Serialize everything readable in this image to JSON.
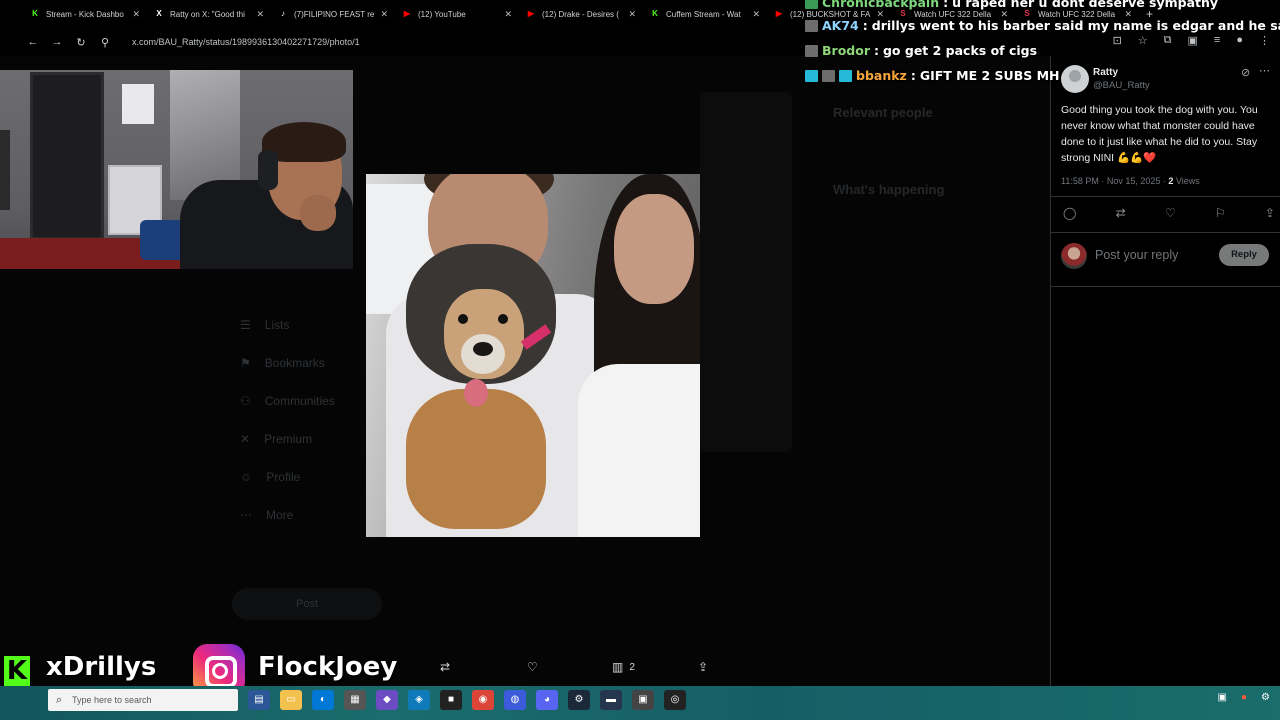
{
  "browser": {
    "tabs": [
      {
        "label": "Stream - Kick Dashbo",
        "icon": "kick-icon",
        "color": "#53fc18"
      },
      {
        "label": "Ratty on X: \"Good thi",
        "icon": "x-icon",
        "color": "#ffffff"
      },
      {
        "label": "(7)FILIPINO FEAST re",
        "icon": "tiktok-icon",
        "color": "#ffffff"
      },
      {
        "label": "(12) YouTube",
        "icon": "youtube-icon",
        "color": "#ff0000"
      },
      {
        "label": "(12) Drake - Desires (",
        "icon": "youtube-icon",
        "color": "#ff0000"
      },
      {
        "label": "Cuffem Stream - Wat",
        "icon": "kick-icon",
        "color": "#53fc18"
      },
      {
        "label": "(12) BUCKSHOT & FA",
        "icon": "youtube-icon",
        "color": "#ff0000"
      },
      {
        "label": "Watch UFC 322 Della",
        "icon": "streameast-icon",
        "color": "#e0324b"
      },
      {
        "label": "Watch UFC 322 Della",
        "icon": "streameast-icon",
        "color": "#e0324b"
      }
    ],
    "url": "x.com/BAU_Ratty/status/1989936130402271729/photo/1"
  },
  "chat": {
    "messages": [
      {
        "user": "Chronicbackpain",
        "text": "u raped her u dont deserve sympathy",
        "user_color": "#7dd87d"
      },
      {
        "user": "AK74",
        "text": "drillys went to his barber said my name is edgar and he said say less",
        "user_color": "#8fd3ff"
      },
      {
        "user": "Brodor",
        "text": "go get 2 packs of cigs",
        "user_color": "#8fd67a"
      },
      {
        "user": "bbankz",
        "text": "GIFT ME 2 SUBS MH",
        "user_color": "#f7a53c"
      }
    ]
  },
  "background_page": {
    "nav": [
      "Lists",
      "Bookmarks",
      "Communities",
      "Premium",
      "Profile",
      "More"
    ],
    "post_button": "Post",
    "relevant_heading": "Relevant people",
    "happening_heading": "What's happening"
  },
  "tweet": {
    "display_name": "Ratty",
    "handle": "@BAU_Ratty",
    "text": "Good thing you took the dog with you. You never know what that monster could have done to it just like what he did to you. Stay strong NINI 💪💪❤️",
    "time": "11:58 PM · Nov 15, 2025 · ",
    "views_count": "2",
    "views_label": " Views",
    "reply_placeholder": "Post your reply",
    "reply_button": "Reply"
  },
  "viewer": {
    "views_count": "2"
  },
  "branding": {
    "kick_letter": "K",
    "kick_name": "xDrillys",
    "instagram_name": "FlockJoey"
  },
  "taskbar": {
    "search_placeholder": "Type here to search"
  },
  "colors": {
    "kick_green": "#53fc18",
    "x_text": "#e7e9ea",
    "x_muted": "#71767b"
  }
}
